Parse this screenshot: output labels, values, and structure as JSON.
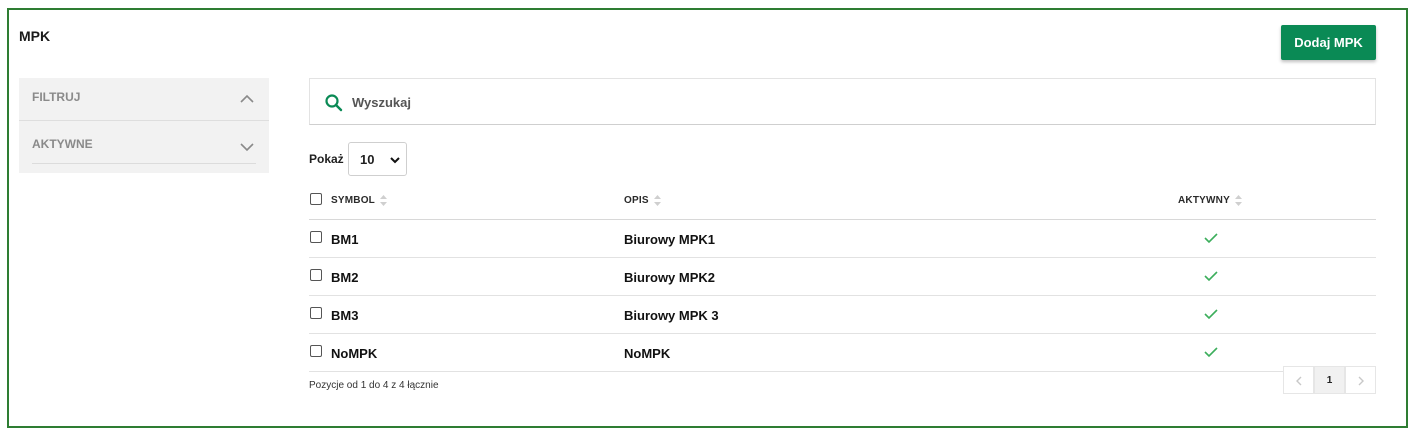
{
  "page": {
    "title": "MPK",
    "add_button": "Dodaj MPK"
  },
  "filters": {
    "header": "FILTRUJ",
    "items": [
      {
        "label": "AKTYWNE"
      }
    ]
  },
  "search": {
    "placeholder": "Wyszukaj",
    "value": ""
  },
  "pagination_size": {
    "label": "Pokaż",
    "selected": "10"
  },
  "table": {
    "columns": [
      "SYMBOL",
      "OPIS",
      "AKTYWNY"
    ],
    "rows": [
      {
        "symbol": "BM1",
        "opis": "Biurowy MPK1",
        "aktywny": true
      },
      {
        "symbol": "BM2",
        "opis": "Biurowy MPK2",
        "aktywny": true
      },
      {
        "symbol": "BM3",
        "opis": "Biurowy MPK 3",
        "aktywny": true
      },
      {
        "symbol": "NoMPK",
        "opis": "NoMPK",
        "aktywny": true
      }
    ]
  },
  "footer": {
    "summary": "Pozycje od 1 do 4 z 4 łącznie",
    "current_page": "1"
  },
  "colors": {
    "accent": "#0a8a55",
    "frame": "#2e7d32",
    "check": "#3cae5c"
  },
  "icons": {
    "search": "search-icon",
    "filter_header": "chevron-up-icon",
    "filter_item": "chevron-down-icon",
    "active": "check-icon",
    "sort": "sort-icon",
    "prev": "chevron-left-icon",
    "next": "chevron-right-icon"
  }
}
